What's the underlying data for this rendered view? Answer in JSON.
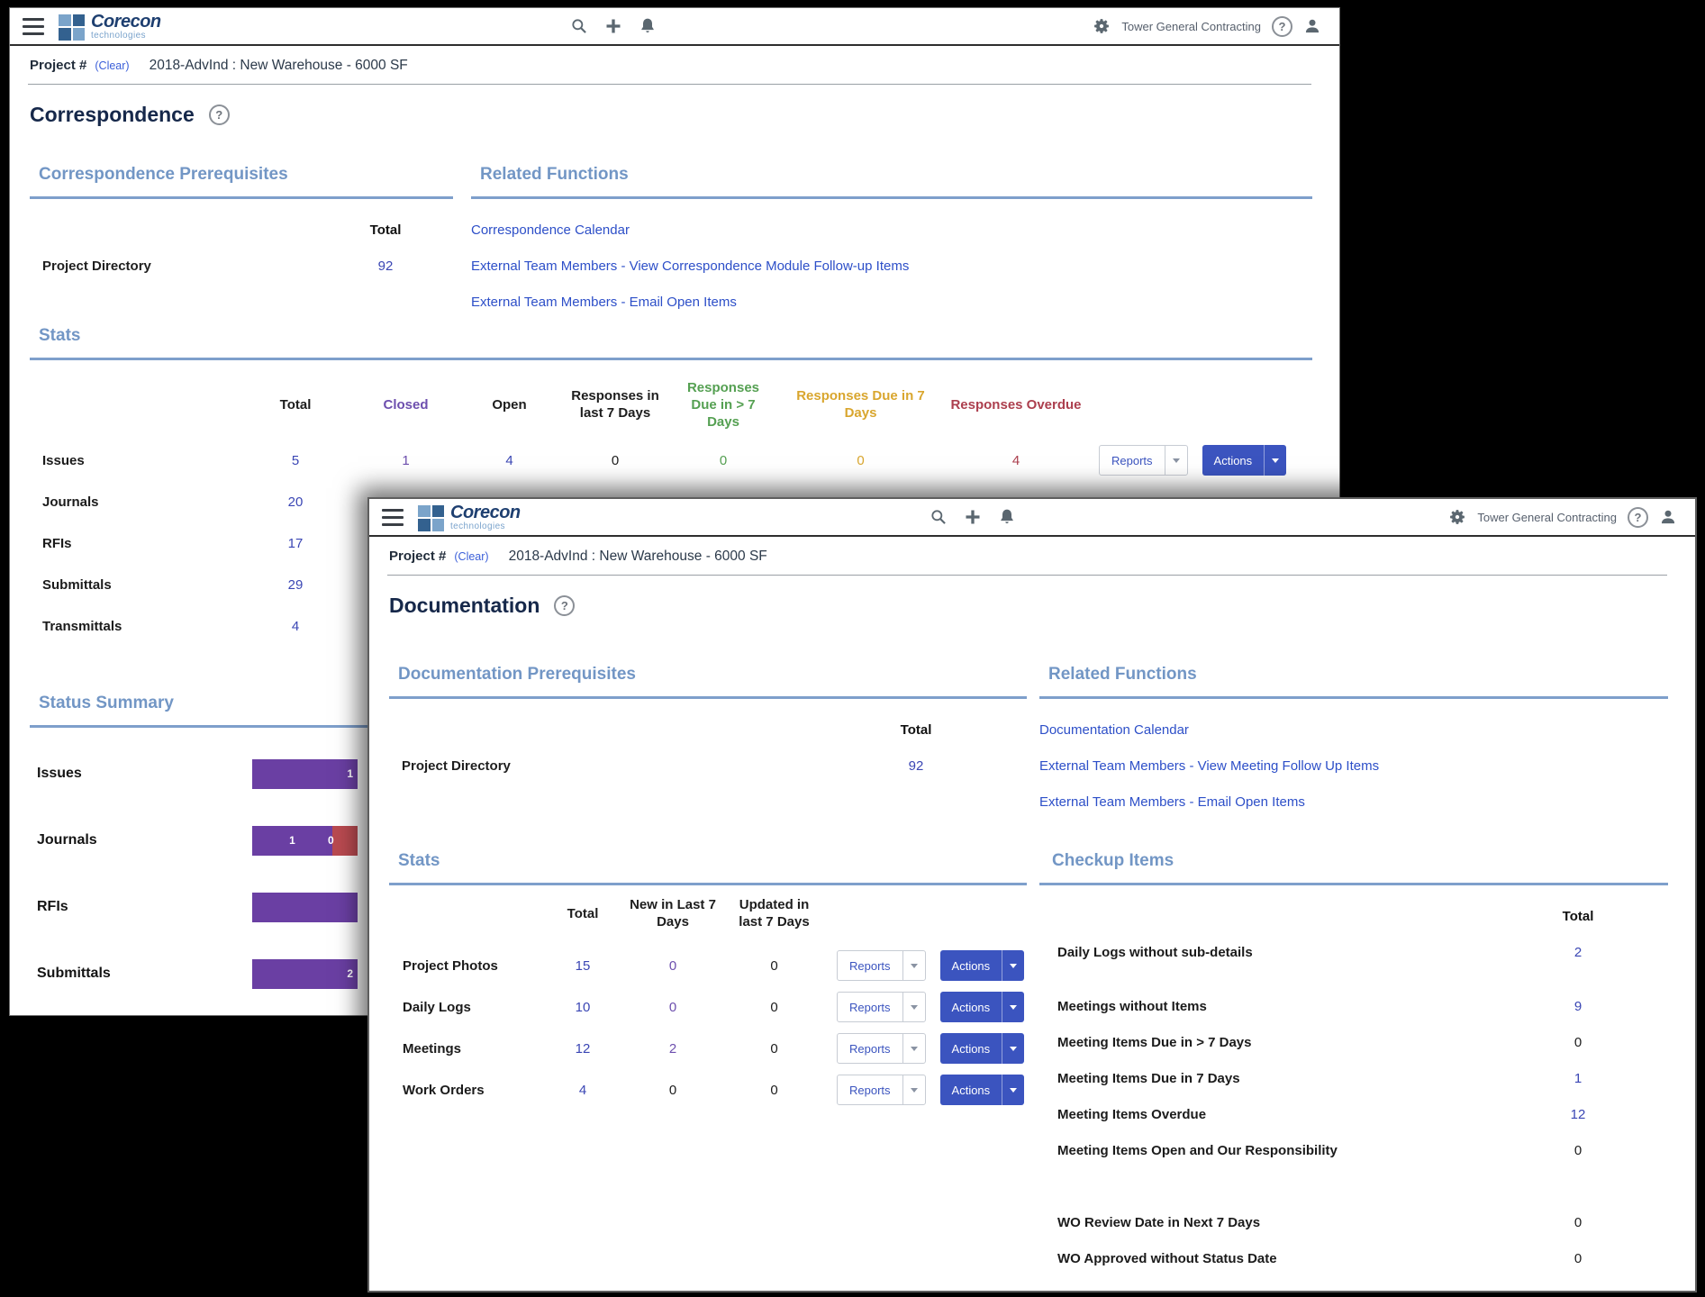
{
  "chrome": {
    "brand": "Corecon",
    "brand_sub": "technologies",
    "company": "Tower General Contracting",
    "help_glyph": "?"
  },
  "project_bar": {
    "label": "Project #",
    "clear_link": "(Clear)",
    "value": "2018-AdvInd : New Warehouse - 6000 SF"
  },
  "colors": {
    "action_blue": "#3b54bf",
    "link_blue": "#2d4fc8",
    "number_blue": "#3a46b4",
    "heading_blue": "#7296c5",
    "closed_purple": "#6d4fae",
    "due_gt7_green": "#55a052",
    "due7_gold": "#d9a62e",
    "overdue_red": "#ac3f4e",
    "bar_purple": "#6a3fa3",
    "bar_red": "#b94a50"
  },
  "correspondence": {
    "title": "Correspondence",
    "prerequisites": {
      "heading": "Correspondence Prerequisites",
      "total_header": "Total",
      "rows": [
        {
          "label": "Project Directory",
          "total": "92"
        }
      ]
    },
    "related_functions": {
      "heading": "Related Functions",
      "links": [
        "Correspondence Calendar",
        "External Team Members - View Correspondence Module Follow-up Items",
        "External Team Members - Email Open Items"
      ]
    },
    "stats": {
      "heading": "Stats",
      "columns": [
        "Total",
        "Closed",
        "Open",
        "Responses in last 7 Days",
        "Responses Due in > 7 Days",
        "Responses Due in 7 Days",
        "Responses Overdue"
      ],
      "reports_label": "Reports",
      "actions_label": "Actions",
      "rows": [
        {
          "label": "Issues",
          "total": "5",
          "closed": "1",
          "open": "4",
          "responses_last7": "0",
          "due_gt7": "0",
          "due7": "0",
          "overdue": "4"
        },
        {
          "label": "Journals",
          "total": "20",
          "closed": "",
          "open": "",
          "responses_last7": "",
          "due_gt7": "",
          "due7": "",
          "overdue": ""
        },
        {
          "label": "RFIs",
          "total": "17",
          "closed": "",
          "open": "",
          "responses_last7": "",
          "due_gt7": "",
          "due7": "",
          "overdue": ""
        },
        {
          "label": "Submittals",
          "total": "29",
          "closed": "",
          "open": "",
          "responses_last7": "",
          "due_gt7": "",
          "due7": "",
          "overdue": ""
        },
        {
          "label": "Transmittals",
          "total": "4",
          "closed": "",
          "open": "",
          "responses_last7": "",
          "due_gt7": "",
          "due7": "",
          "overdue": ""
        }
      ]
    },
    "status_summary": {
      "heading": "Status Summary",
      "chart_type": "stacked-bar",
      "rows": [
        {
          "label": "Issues",
          "segments": [
            {
              "color": "purple",
              "value": "1"
            }
          ]
        },
        {
          "label": "Journals",
          "segments": [
            {
              "color": "purple",
              "value": "1"
            },
            {
              "color": "red",
              "value": "0"
            }
          ]
        },
        {
          "label": "RFIs",
          "segments": [
            {
              "color": "purple",
              "value": ""
            }
          ]
        },
        {
          "label": "Submittals",
          "segments": [
            {
              "color": "purple",
              "value": "2"
            }
          ]
        }
      ]
    }
  },
  "documentation": {
    "title": "Documentation",
    "prerequisites": {
      "heading": "Documentation Prerequisites",
      "total_header": "Total",
      "rows": [
        {
          "label": "Project Directory",
          "total": "92"
        }
      ]
    },
    "related_functions": {
      "heading": "Related Functions",
      "links": [
        "Documentation Calendar",
        "External Team Members - View Meeting Follow Up Items",
        "External Team Members - Email Open Items"
      ]
    },
    "stats": {
      "heading": "Stats",
      "columns": [
        "Total",
        "New in Last 7 Days",
        "Updated in last 7 Days"
      ],
      "reports_label": "Reports",
      "actions_label": "Actions",
      "rows": [
        {
          "label": "Project Photos",
          "total": "15",
          "new_last7": "0",
          "updated_last7": "0"
        },
        {
          "label": "Daily Logs",
          "total": "10",
          "new_last7": "0",
          "updated_last7": "0"
        },
        {
          "label": "Meetings",
          "total": "12",
          "new_last7": "2",
          "updated_last7": "0"
        },
        {
          "label": "Work Orders",
          "total": "4",
          "new_last7": "0",
          "updated_last7": "0"
        }
      ]
    },
    "checkup": {
      "heading": "Checkup Items",
      "total_header": "Total",
      "rows": [
        {
          "label": "Daily Logs without sub-details",
          "total": "2"
        },
        {
          "label": "Meetings without Items",
          "total": "9"
        },
        {
          "label": "Meeting Items Due in > 7 Days",
          "total": "0"
        },
        {
          "label": "Meeting Items Due in 7 Days",
          "total": "1"
        },
        {
          "label": "Meeting Items Overdue",
          "total": "12"
        },
        {
          "label": "Meeting Items Open and Our Responsibility",
          "total": "0"
        }
      ],
      "wo_rows": [
        {
          "label": "WO Review Date in Next 7 Days",
          "total": "0"
        },
        {
          "label": "WO Approved without Status Date",
          "total": "0"
        }
      ]
    }
  }
}
